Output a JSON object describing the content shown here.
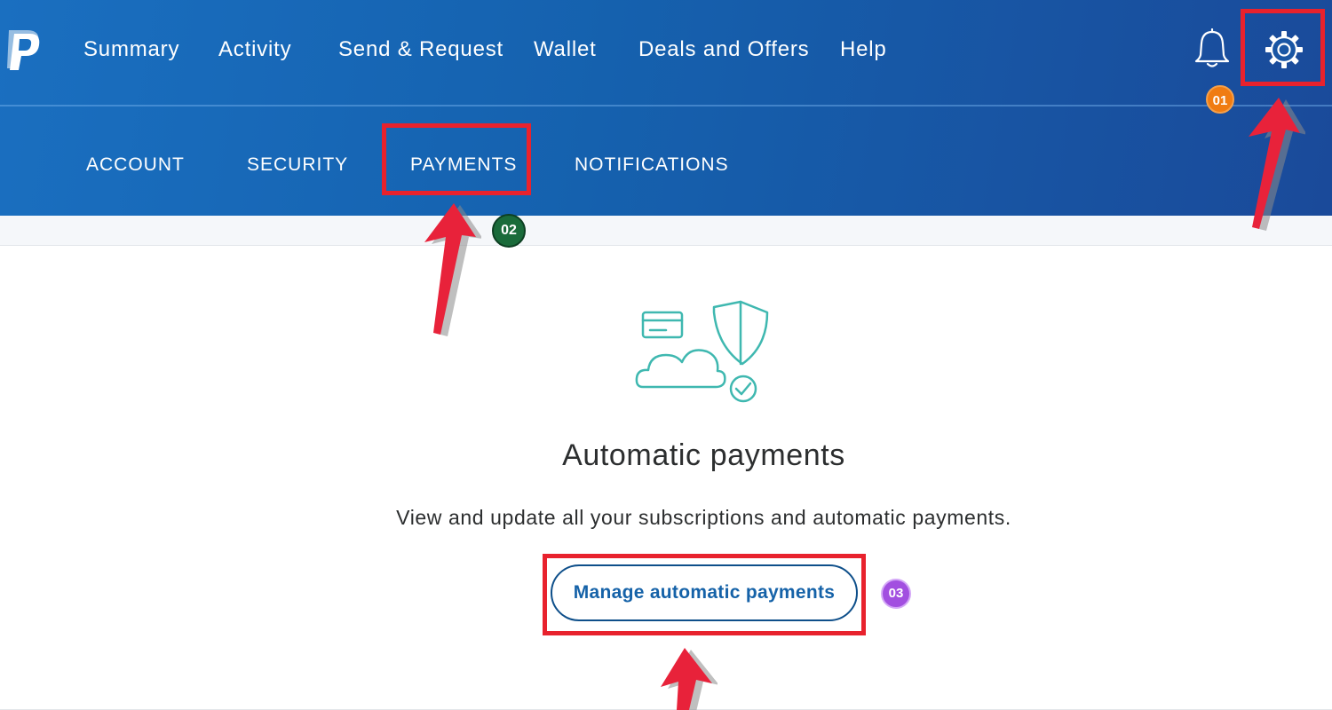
{
  "top_nav": {
    "items": [
      {
        "label": "Summary"
      },
      {
        "label": "Activity"
      },
      {
        "label": "Send & Request"
      },
      {
        "label": "Wallet"
      },
      {
        "label": "Deals and Offers"
      },
      {
        "label": "Help"
      }
    ],
    "notification_icon": "bell-icon",
    "settings_icon": "gear-icon"
  },
  "settings_tabs": {
    "items": [
      {
        "label": "ACCOUNT"
      },
      {
        "label": "SECURITY"
      },
      {
        "label": "PAYMENTS",
        "selected": true
      },
      {
        "label": "NOTIFICATIONS"
      }
    ]
  },
  "card": {
    "illustration_icon": "payments-cloud-shield-icon",
    "title": "Automatic payments",
    "description": "View and update all your subscriptions and automatic payments.",
    "button_label": "Manage automatic payments"
  },
  "annotations": {
    "step1": "01",
    "step2": "02",
    "step3": "03"
  },
  "colors": {
    "header_blue": "#1561ae",
    "highlight_red": "#e8222d",
    "badge1": "#f07c12",
    "badge2": "#1a6b3a",
    "badge3": "#a24fe0",
    "illustration_teal": "#3fb8b0",
    "button_text": "#1562a8"
  }
}
